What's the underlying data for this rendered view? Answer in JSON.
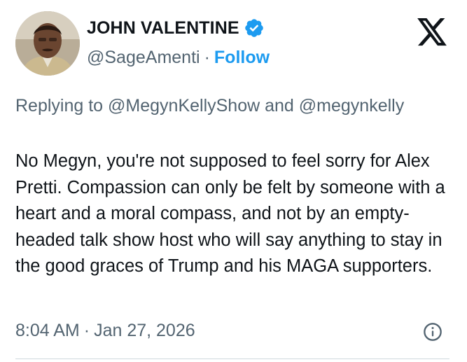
{
  "author": {
    "display_name": "JOHN VALENTINE",
    "handle": "@SageAmenti",
    "separator": "·",
    "follow_label": "Follow",
    "verified_icon": "verified-badge-icon",
    "avatar": "avatar-photo"
  },
  "platform_logo": "x-logo-icon",
  "reply": {
    "prefix": "Replying to",
    "mentions": [
      "@MegynKellyShow",
      "@megynkelly"
    ],
    "joiner": "and"
  },
  "tweet": {
    "text": "No Megyn, you're not supposed to feel sorry for Alex Pretti. Compassion can only be felt by someone with a heart and a moral compass, and not by an empty-headed talk show host who will say anything to stay in the good graces of Trump and his MAGA supporters."
  },
  "meta": {
    "time": "8:04 AM",
    "separator": "·",
    "date": "Jan 27, 2026",
    "info_icon": "info-icon"
  },
  "colors": {
    "text": "#0f1419",
    "secondary": "#536471",
    "accent": "#1d9bf0",
    "divider": "#cfd9de"
  }
}
